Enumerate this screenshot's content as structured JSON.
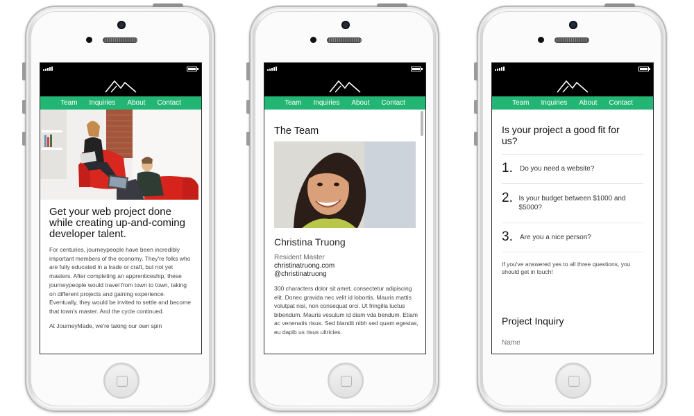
{
  "nav": [
    "Team",
    "Inquiries",
    "About",
    "Contact"
  ],
  "screen1": {
    "headline": "Get your web project done while creating up-and-coming developer talent.",
    "paragraph1": "For centuries, journeypeople have been incredibly important members of the economy. They're folks who are fully educated in a trade or craft, but not yet masters. After completing an apprenticeship, these journeypeople would travel from town to town, taking on different projects and gaining experience. Eventually, they would be invited to settle and become that town's master. And the cycle continued.",
    "paragraph2": "At JourneyMade, we're taking our own spin"
  },
  "screen2": {
    "title": "The Team",
    "name": "Christina Truong",
    "role": "Resident Master",
    "website": "christinatruong.com",
    "handle": "@christinatruong",
    "bio": "300 characters dolor sit amet, consectetur adipiscing elit. Donec gravida nec velit id lobortis. Mauris mattis volutpat nisi, non consequat orci. Ut fringilla luctus bibendum. Mauris vesulum id diam vda bendum. Etiam ac venenatis risus. Sed blandit nibh sed quam egestas, eu dapib us risus ultricies."
  },
  "screen3": {
    "title": "Is your project a good fit for us?",
    "questions": [
      {
        "num": "1.",
        "text": "Do you need a website?"
      },
      {
        "num": "2.",
        "text": "Is your budget between $1000 and $5000?"
      },
      {
        "num": "3.",
        "text": "Are you a nice person?"
      }
    ],
    "note": "If you've answered yes to all three questions, you should get in touch!",
    "inquiry_title": "Project Inquiry",
    "name_placeholder": "Name"
  },
  "colors": {
    "accent": "#22b573",
    "header": "#000000"
  },
  "icons": {
    "logo": "mountain-logo-icon",
    "signal": "signal-bars-icon",
    "battery": "battery-icon"
  }
}
